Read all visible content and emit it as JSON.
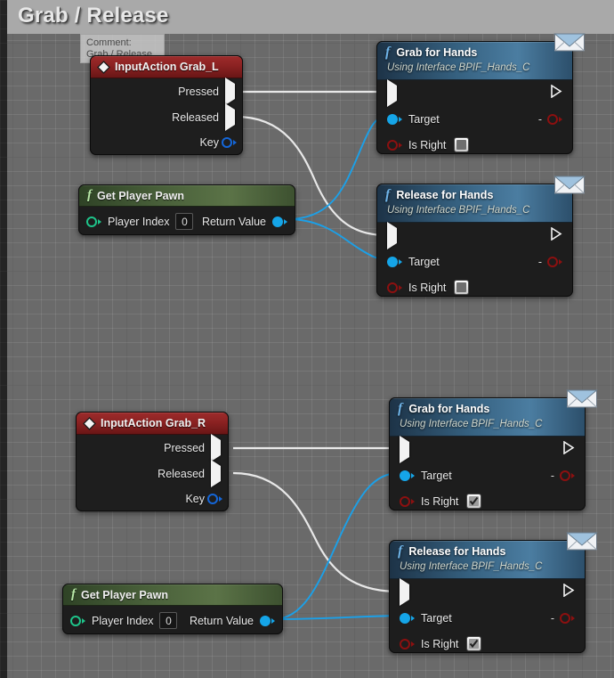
{
  "comment": {
    "title": "Grab / Release",
    "tooltip": {
      "label": "Comment:",
      "value": "Grab / Release"
    }
  },
  "nodes": {
    "input_grab_l": {
      "title": "InputAction Grab_L",
      "icon": "diamond-icon",
      "outputs": [
        {
          "label": "Pressed",
          "type": "exec"
        },
        {
          "label": "Released",
          "type": "exec"
        },
        {
          "label": "Key",
          "type": "struct"
        }
      ]
    },
    "input_grab_r": {
      "title": "InputAction Grab_R",
      "icon": "diamond-icon",
      "outputs": [
        {
          "label": "Pressed",
          "type": "exec"
        },
        {
          "label": "Released",
          "type": "exec"
        },
        {
          "label": "Key",
          "type": "struct"
        }
      ]
    },
    "get_player_pawn_top": {
      "title": "Get Player Pawn",
      "icon": "function-icon",
      "input_label": "Player Index",
      "input_value": "0",
      "output_label": "Return Value"
    },
    "get_player_pawn_bottom": {
      "title": "Get Player Pawn",
      "icon": "function-icon",
      "input_label": "Player Index",
      "input_value": "0",
      "output_label": "Return Value"
    },
    "grab_for_hands_left": {
      "title": "Grab for Hands",
      "subtitle": "Using Interface BPIF_Hands_C",
      "icon": "function-icon",
      "badge": "envelope-icon",
      "target_label": "Target",
      "is_right_label": "Is Right",
      "is_right_checked": false,
      "return_dash": "-"
    },
    "release_for_hands_left": {
      "title": "Release for Hands",
      "subtitle": "Using Interface BPIF_Hands_C",
      "icon": "function-icon",
      "badge": "envelope-icon",
      "target_label": "Target",
      "is_right_label": "Is Right",
      "is_right_checked": false,
      "return_dash": "-"
    },
    "grab_for_hands_right": {
      "title": "Grab for Hands",
      "subtitle": "Using Interface BPIF_Hands_C",
      "icon": "function-icon",
      "badge": "envelope-icon",
      "target_label": "Target",
      "is_right_label": "Is Right",
      "is_right_checked": true,
      "return_dash": "-"
    },
    "release_for_hands_right": {
      "title": "Release for Hands",
      "subtitle": "Using Interface BPIF_Hands_C",
      "icon": "function-icon",
      "badge": "envelope-icon",
      "target_label": "Target",
      "is_right_label": "Is Right",
      "is_right_checked": true,
      "return_dash": "-"
    }
  },
  "colors": {
    "exec_wire": "#e8e8e8",
    "object_wire": "#1ba0e8",
    "object_pin": "#15a5e8",
    "bool_pin": "#8c1010",
    "int_pin": "#1ec48a",
    "struct_pin": "#1466d8",
    "comment_title_bar": "#a9a9a9",
    "comment_body": "#6a6a6a",
    "node_body": "#1d1d1d",
    "header_red": "#8b2222",
    "header_green": "#49603a",
    "header_blue": "#35607f"
  }
}
